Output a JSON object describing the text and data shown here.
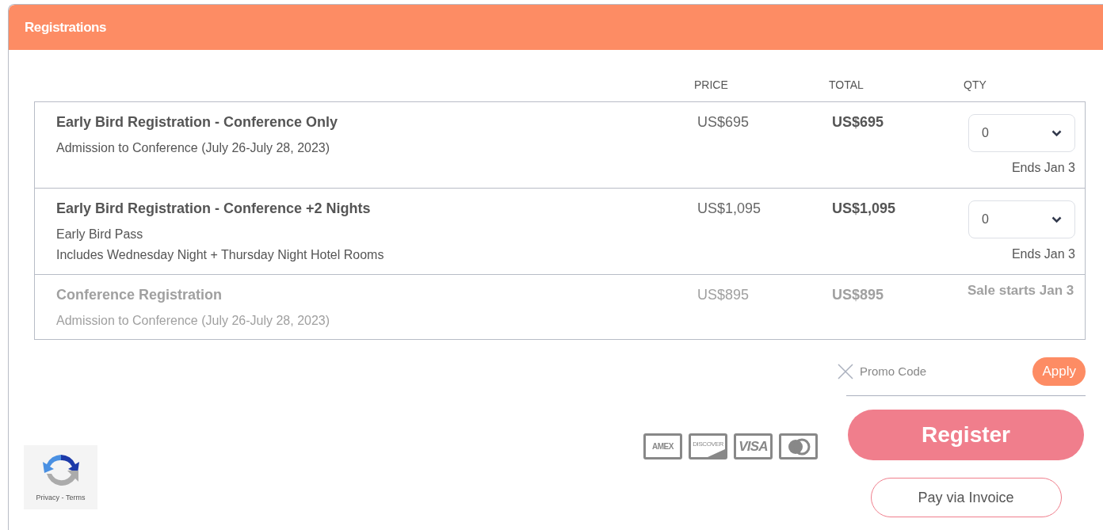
{
  "panel": {
    "title": "Registrations"
  },
  "columns": [
    "PRICE",
    "TOTAL",
    "QTY"
  ],
  "tickets": [
    {
      "name": "Early Bird Registration - Conference Only",
      "details": [
        "Admission to Conference (July 26-July 28, 2023)"
      ],
      "price": "US$695",
      "total": "US$695",
      "disabled": false,
      "quantity": "0",
      "note": "Ends Jan 3"
    },
    {
      "name": "Early Bird Registration - Conference +2 Nights",
      "details": [
        "Early Bird Pass",
        "Includes Wednesday Night + Thursday Night Hotel Rooms"
      ],
      "price": "US$1,095",
      "total": "US$1,095",
      "disabled": false,
      "quantity": "0",
      "note": "Ends Jan 3"
    },
    {
      "name": "Conference Registration",
      "details": [
        "Admission to Conference (July 26-July 28, 2023)"
      ],
      "price": "US$895",
      "total": "US$895",
      "disabled": true,
      "note": "Sale starts Jan 3"
    }
  ],
  "promo": {
    "placeholder": "Promo Code",
    "apply": "Apply"
  },
  "cards": [
    {
      "kind": "amex",
      "label": "AMEX"
    },
    {
      "kind": "discover",
      "label": "DISCOVER"
    },
    {
      "kind": "visa",
      "label": "VISA"
    },
    {
      "kind": "mastercard"
    }
  ],
  "register": "Register",
  "invoice": "Pay via Invoice",
  "captcha": {
    "links": "Privacy - Terms"
  }
}
